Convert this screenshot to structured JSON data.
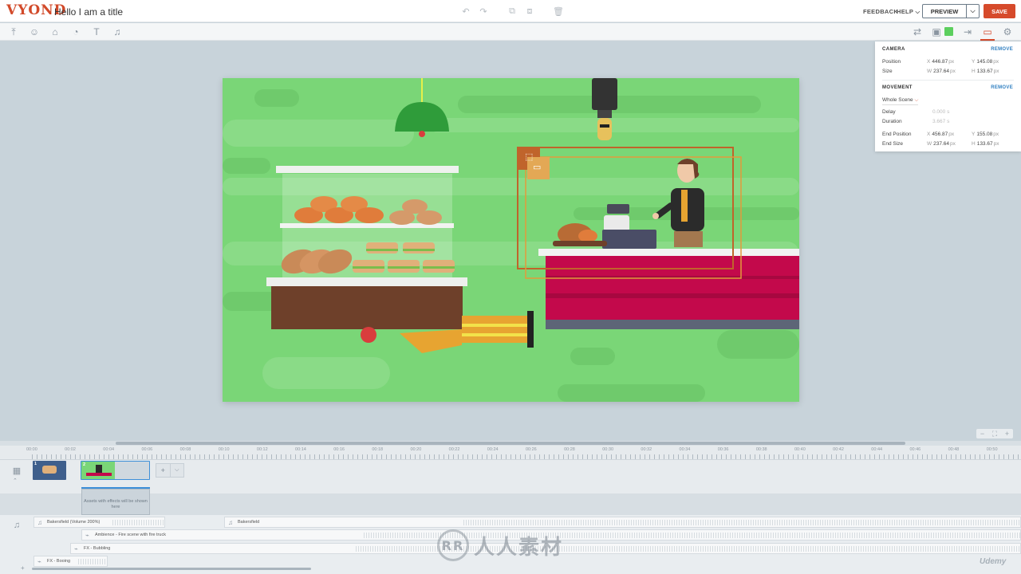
{
  "app": {
    "logo": "VYOND",
    "project_title": "Hello I am a title"
  },
  "topbar": {
    "feedback": "FEEDBACK",
    "help": "HELP",
    "help_caret": "⌵",
    "preview": "PREVIEW",
    "preview_caret": "⌵",
    "save": "SAVE",
    "icons": [
      "undo-icon",
      "redo-icon",
      "copy-icon",
      "paste-icon",
      "delete-icon"
    ]
  },
  "toolbar": {
    "left_tools": [
      "upload-icon",
      "character-icon",
      "props-icon",
      "chart-icon",
      "text-icon",
      "audio-icon"
    ],
    "right_tools": [
      "swap-icon",
      "image-icon",
      "color-swatch",
      "enter-icon",
      "camera-icon",
      "settings-icon"
    ],
    "swatch_color": "#5ccf5e",
    "accent": "#d64a2b"
  },
  "inspector": {
    "camera_heading": "CAMERA",
    "camera_remove": "REMOVE",
    "position_label": "Position",
    "position_x": "446.87",
    "position_y": "145.08",
    "size_label": "Size",
    "size_w": "237.64",
    "size_h": "133.67",
    "movement_heading": "MOVEMENT",
    "movement_remove": "REMOVE",
    "movement_select": "Whole Scene",
    "delay_label": "Delay",
    "delay_value": "0.000",
    "delay_unit": "s",
    "duration_label": "Duration",
    "duration_value": "3.667",
    "duration_unit": "s",
    "end_position_label": "End Position",
    "end_position_x": "456.87",
    "end_position_y": "155.08",
    "end_size_label": "End Size",
    "end_size_w": "237.64",
    "end_size_h": "133.67",
    "k_x": "X",
    "k_y": "Y",
    "k_w": "W",
    "k_h": "H",
    "unit_px": "px"
  },
  "zoom": {
    "minus": "−",
    "fit": "⛶",
    "plus": "+"
  },
  "timeline": {
    "ruler": [
      "00:00",
      "00:02",
      "00:04",
      "00:06",
      "00:08",
      "00:10",
      "00:12",
      "00:14",
      "00:16",
      "00:18",
      "00:20",
      "00:22",
      "00:24",
      "00:26",
      "00:28",
      "00:30",
      "00:32",
      "00:34",
      "00:36",
      "00:38",
      "00:40",
      "00:42",
      "00:44",
      "00:46",
      "00:48",
      "00:50"
    ],
    "scenes": [
      {
        "number": "1"
      },
      {
        "number": "2"
      }
    ],
    "add_scene": "+",
    "add_scene_caret": "⌵",
    "effects_hint": "Assets with effects will be shown here",
    "audio_tracks": [
      {
        "name": "Bakersfield (Volume 200%)"
      },
      {
        "name": "Bakersfield"
      },
      {
        "name": "Ambience - Fire scene with fire truck"
      },
      {
        "name": "FX - Bubbling"
      },
      {
        "name": "FX - Booing"
      }
    ]
  },
  "watermark": {
    "text": "人人素材",
    "udemy": "Udemy"
  }
}
